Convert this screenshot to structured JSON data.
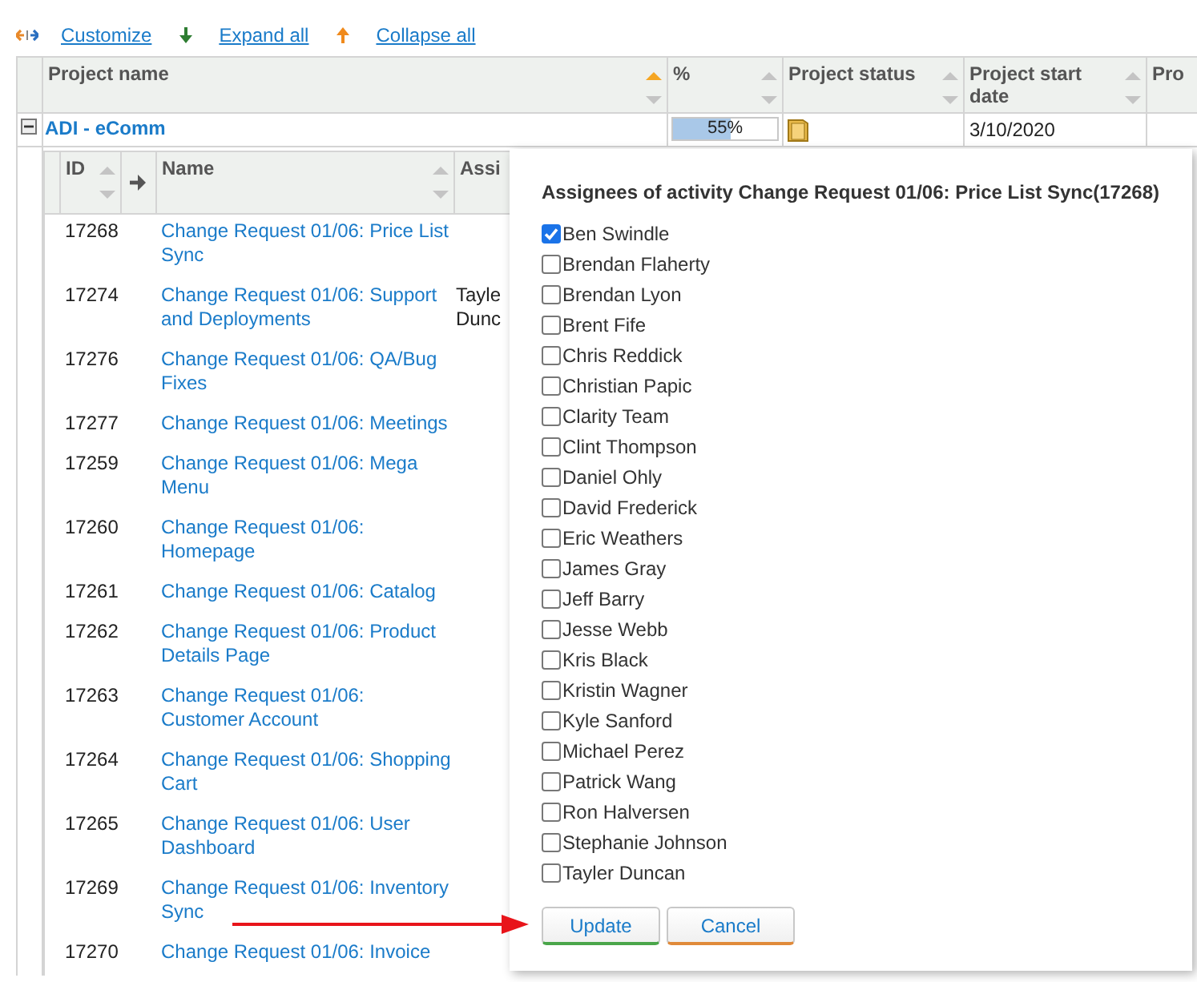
{
  "toolbar": [
    {
      "kind": "customize",
      "label": "Customize"
    },
    {
      "kind": "expand",
      "label": "Expand all"
    },
    {
      "kind": "collapse",
      "label": "Collapse all"
    }
  ],
  "project_table": {
    "columns": [
      {
        "label": "Project name",
        "sorted": true
      },
      {
        "label": "%",
        "sorted": false
      },
      {
        "label": "Project status",
        "sorted": false
      },
      {
        "label": "Project start date",
        "sorted": false
      },
      {
        "label": "Pro"
      }
    ],
    "rows": [
      {
        "name": "ADI - eComm",
        "expanded": true,
        "progress": {
          "level": 0.55,
          "reading": "55%"
        },
        "start_date": "3/10/2020"
      }
    ]
  },
  "activity_table": {
    "columns": [
      {
        "kind": "text",
        "label": "ID",
        "sortable": true
      },
      {
        "kind": "arrow"
      },
      {
        "kind": "text",
        "label": "Name",
        "sortable": true
      },
      {
        "kind": "text",
        "label": "Assi",
        "sortable": false
      }
    ],
    "rows": [
      {
        "id": "17268",
        "name": "Change Request 01/06: Price List Sync"
      },
      {
        "id": "17274",
        "name": "Change Request 01/06: Support and Deployments",
        "assignee": "Tayle Dunc"
      },
      {
        "id": "17276",
        "name": "Change Request 01/06: QA/Bug Fixes"
      },
      {
        "id": "17277",
        "name": "Change Request 01/06: Meetings"
      },
      {
        "id": "17259",
        "name": "Change Request 01/06: Mega Menu"
      },
      {
        "id": "17260",
        "name": "Change Request 01/06: Homepage"
      },
      {
        "id": "17261",
        "name": "Change Request 01/06: Catalog"
      },
      {
        "id": "17262",
        "name": "Change Request 01/06: Product Details Page"
      },
      {
        "id": "17263",
        "name": "Change Request 01/06: Customer Account"
      },
      {
        "id": "17264",
        "name": "Change Request 01/06: Shopping Cart"
      },
      {
        "id": "17265",
        "name": "Change Request 01/06: User Dashboard"
      },
      {
        "id": "17269",
        "name": "Change Request 01/06: Inventory Sync"
      },
      {
        "id": "17270",
        "name": "Change Request 01/06: Invoice"
      }
    ]
  },
  "popup": {
    "title": "Assignees of activity Change Request 01/06: Price List Sync(17268)",
    "assignees": [
      {
        "name": "Ben Swindle",
        "checked": true
      },
      {
        "name": "Brendan Flaherty",
        "checked": false
      },
      {
        "name": "Brendan Lyon",
        "checked": false
      },
      {
        "name": "Brent Fife",
        "checked": false
      },
      {
        "name": "Chris Reddick",
        "checked": false
      },
      {
        "name": "Christian Papic",
        "checked": false
      },
      {
        "name": "Clarity Team",
        "checked": false
      },
      {
        "name": "Clint Thompson",
        "checked": false
      },
      {
        "name": "Daniel Ohly",
        "checked": false
      },
      {
        "name": "David Frederick",
        "checked": false
      },
      {
        "name": "Eric Weathers",
        "checked": false
      },
      {
        "name": "James Gray",
        "checked": false
      },
      {
        "name": "Jeff Barry",
        "checked": false
      },
      {
        "name": "Jesse Webb",
        "checked": false
      },
      {
        "name": "Kris Black",
        "checked": false
      },
      {
        "name": "Kristin Wagner",
        "checked": false
      },
      {
        "name": "Kyle Sanford",
        "checked": false
      },
      {
        "name": "Michael Perez",
        "checked": false
      },
      {
        "name": "Patrick Wang",
        "checked": false
      },
      {
        "name": "Ron Halversen",
        "checked": false
      },
      {
        "name": "Stephanie Johnson",
        "checked": false
      },
      {
        "name": "Tayler Duncan",
        "checked": false
      }
    ],
    "buttons": [
      {
        "kind": "update",
        "label": "Update"
      },
      {
        "kind": "cancel",
        "label": "Cancel"
      }
    ]
  }
}
